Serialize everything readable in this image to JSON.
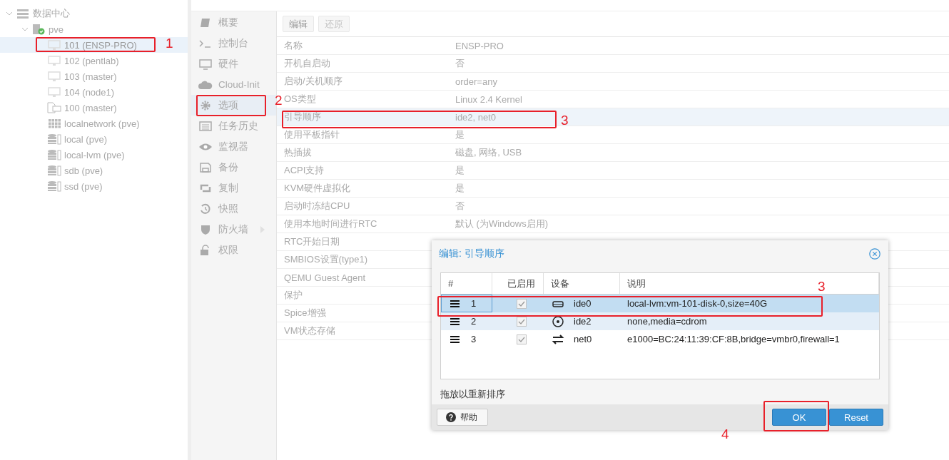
{
  "tree": {
    "root": {
      "label": "数据中心",
      "expanded": true,
      "children": [
        {
          "label": "pve",
          "kind": "node",
          "expanded": true,
          "children": [
            {
              "label": "101 (ENSP-PRO)",
              "kind": "vm",
              "selected": true
            },
            {
              "label": "102 (pentlab)",
              "kind": "vm",
              "selected": false
            },
            {
              "label": "103 (master)",
              "kind": "vm",
              "selected": false
            },
            {
              "label": "104 (node1)",
              "kind": "vm",
              "selected": false
            },
            {
              "label": "100 (master)",
              "kind": "template",
              "selected": false
            },
            {
              "label": "localnetwork (pve)",
              "kind": "network",
              "selected": false
            },
            {
              "label": "local (pve)",
              "kind": "storage",
              "selected": false
            },
            {
              "label": "local-lvm (pve)",
              "kind": "storage",
              "selected": false
            },
            {
              "label": "sdb (pve)",
              "kind": "storage",
              "selected": false
            },
            {
              "label": "ssd (pve)",
              "kind": "storage",
              "selected": false
            }
          ]
        }
      ]
    }
  },
  "nav": [
    {
      "label": "概要",
      "selected": false
    },
    {
      "label": "控制台",
      "selected": false
    },
    {
      "label": "硬件",
      "selected": false
    },
    {
      "label": "Cloud-Init",
      "selected": false
    },
    {
      "label": "选项",
      "selected": true
    },
    {
      "label": "任务历史",
      "selected": false
    },
    {
      "label": "监视器",
      "selected": false
    },
    {
      "label": "备份",
      "selected": false
    },
    {
      "label": "复制",
      "selected": false
    },
    {
      "label": "快照",
      "selected": false
    },
    {
      "label": "防火墙",
      "selected": false,
      "has_submenu": true
    },
    {
      "label": "权限",
      "selected": false
    }
  ],
  "toolbar": {
    "buttons": [
      {
        "label": "编辑",
        "disabled": false
      },
      {
        "label": "还原",
        "disabled": true
      }
    ]
  },
  "options": [
    {
      "key": "名称",
      "value": "ENSP-PRO",
      "selected": false
    },
    {
      "key": "开机自启动",
      "value": "否",
      "selected": false
    },
    {
      "key": "启动/关机顺序",
      "value": "order=any",
      "selected": false
    },
    {
      "key": "OS类型",
      "value": "Linux 2.4 Kernel",
      "selected": false
    },
    {
      "key": "引导顺序",
      "value": "ide2, net0",
      "selected": true
    },
    {
      "key": "使用平板指针",
      "value": "是",
      "selected": false
    },
    {
      "key": "热插拔",
      "value": "磁盘, 网络, USB",
      "selected": false
    },
    {
      "key": "ACPI支持",
      "value": "是",
      "selected": false
    },
    {
      "key": "KVM硬件虚拟化",
      "value": "是",
      "selected": false
    },
    {
      "key": "启动时冻结CPU",
      "value": "否",
      "selected": false
    },
    {
      "key": "使用本地时间进行RTC",
      "value": "默认 (为Windows启用)",
      "selected": false
    },
    {
      "key": "RTC开始日期",
      "selected": false
    },
    {
      "key": "SMBIOS设置(type1)",
      "selected": false
    },
    {
      "key": "QEMU Guest Agent",
      "selected": false
    },
    {
      "key": "保护",
      "selected": false
    },
    {
      "key": "Spice增强",
      "selected": false
    },
    {
      "key": "VM状态存储",
      "selected": false
    }
  ],
  "dialog": {
    "title": "编辑: 引导顺序",
    "columns": [
      "#",
      "已启用",
      "设备",
      "说明"
    ],
    "rows": [
      {
        "index": "1",
        "enabled": true,
        "device": "ide0",
        "description": "local-lvm:vm-101-disk-0,size=40G",
        "selected": true
      },
      {
        "index": "2",
        "enabled": true,
        "device": "ide2",
        "description": "none,media=cdrom",
        "selected": false
      },
      {
        "index": "3",
        "enabled": true,
        "device": "net0",
        "description": "e1000=BC:24:11:39:CF:8B,bridge=vmbr0,firewall=1",
        "selected": false
      }
    ],
    "hint": "拖放以重新排序",
    "help_button": "帮助",
    "ok_button": "OK",
    "reset_button": "Reset"
  },
  "annotations": [
    {
      "number": "1"
    },
    {
      "number": "2"
    },
    {
      "number": "3"
    },
    {
      "number": "3"
    },
    {
      "number": "4"
    }
  ]
}
